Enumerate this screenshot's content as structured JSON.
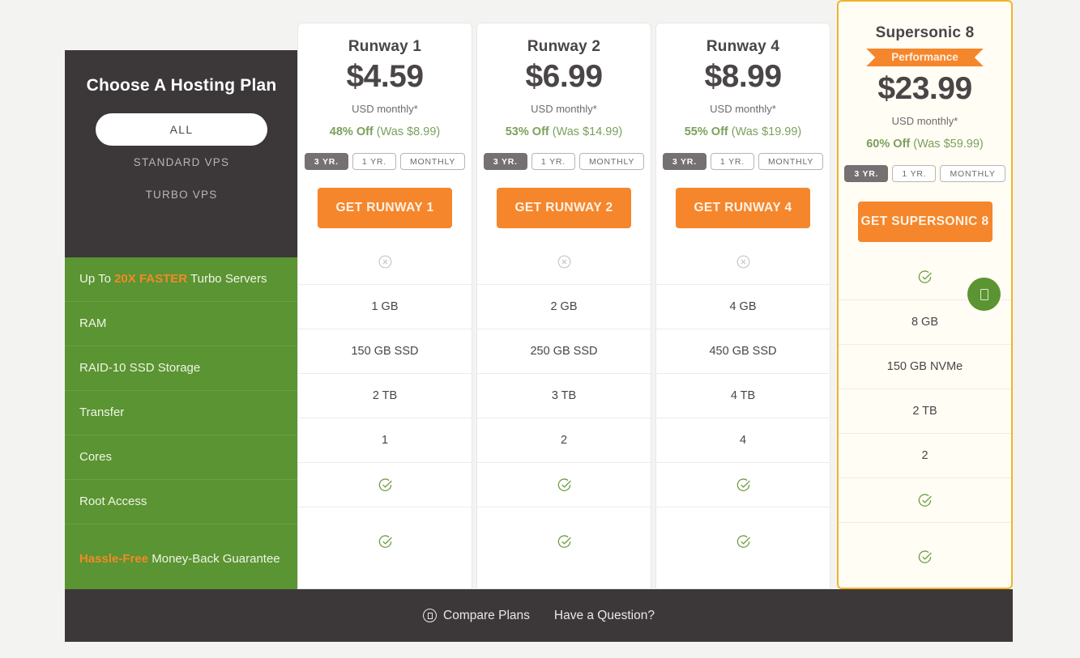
{
  "sidebar": {
    "title": "Choose A Hosting Plan",
    "filters": [
      {
        "label": "ALL",
        "active": true
      },
      {
        "label": "STANDARD VPS",
        "active": false
      },
      {
        "label": "TURBO VPS",
        "active": false
      }
    ],
    "features": [
      {
        "pre": "Up To ",
        "hl": "20X FASTER",
        "post": " Turbo Servers"
      },
      {
        "pre": "RAM",
        "hl": "",
        "post": ""
      },
      {
        "pre": "RAID-10 SSD Storage",
        "hl": "",
        "post": ""
      },
      {
        "pre": "Transfer",
        "hl": "",
        "post": ""
      },
      {
        "pre": "Cores",
        "hl": "",
        "post": ""
      },
      {
        "pre": "Root Access",
        "hl": "",
        "post": ""
      },
      {
        "pre": "",
        "hl": "Hassle-Free",
        "post": " Money-Back Guarantee"
      }
    ]
  },
  "terms_labels": [
    "3 YR.",
    "1 YR.",
    "MONTHLY"
  ],
  "active_term": "3 YR.",
  "price_unit": "USD monthly*",
  "plans": [
    {
      "name": "Runway 1",
      "badge": null,
      "price": "$4.59",
      "unit": "USD monthly*",
      "discount_pct": "48% Off",
      "discount_was": "(Was $8.99)",
      "cta": "GET RUNWAY 1",
      "featured": false,
      "values": [
        "cross",
        "1 GB",
        "150 GB SSD",
        "2 TB",
        "1",
        "check",
        "check"
      ]
    },
    {
      "name": "Runway 2",
      "badge": null,
      "price": "$6.99",
      "unit": "USD monthly*",
      "discount_pct": "53% Off",
      "discount_was": "(Was $14.99)",
      "cta": "GET RUNWAY 2",
      "featured": false,
      "values": [
        "cross",
        "2 GB",
        "250 GB SSD",
        "3 TB",
        "2",
        "check",
        "check"
      ]
    },
    {
      "name": "Runway 4",
      "badge": null,
      "price": "$8.99",
      "unit": "USD monthly*",
      "discount_pct": "55% Off",
      "discount_was": "(Was $19.99)",
      "cta": "GET RUNWAY 4",
      "featured": false,
      "values": [
        "cross",
        "4 GB",
        "450 GB SSD",
        "4 TB",
        "4",
        "check",
        "check"
      ]
    },
    {
      "name": "Supersonic 8",
      "badge": "Performance",
      "price": "$23.99",
      "unit": "USD monthly*",
      "discount_pct": "60% Off",
      "discount_was": "(Was $59.99)",
      "cta": "GET SUPERSONIC 8",
      "featured": true,
      "values": [
        "check",
        "8 GB",
        "150 GB NVMe",
        "2 TB",
        "2",
        "check",
        "check"
      ]
    }
  ],
  "footer": {
    "compare_label": "Compare Plans",
    "question_label": "Have a Question?"
  },
  "colors": {
    "orange": "#f5862b",
    "green": "#5b9432",
    "dark": "#3c383a",
    "discount_green": "#7ba05b",
    "featured_border": "#f0b429",
    "page_bg": "#f3f3f2"
  }
}
